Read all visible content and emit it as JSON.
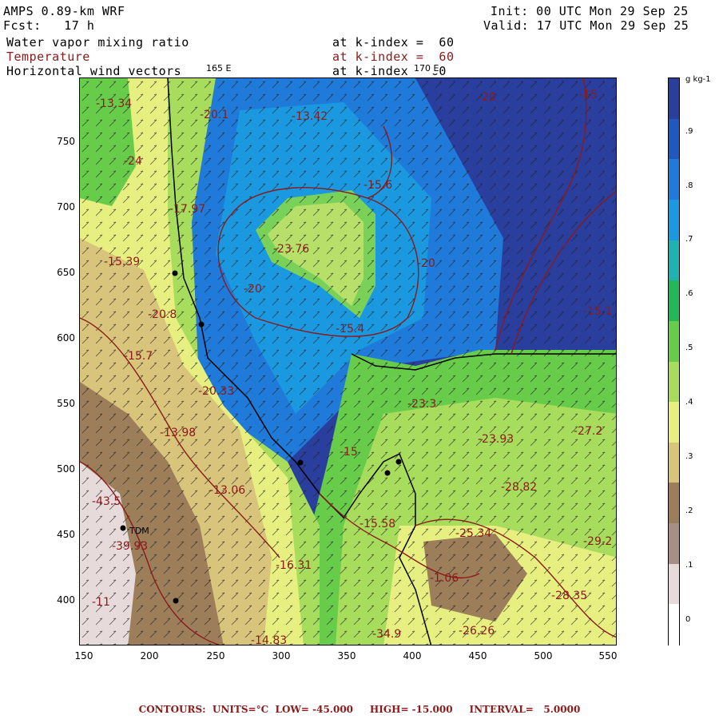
{
  "header": {
    "model": "AMPS 0.89-km WRF",
    "forecast": "Fcst:   17 h",
    "init": "Init: 00 UTC Mon 29 Sep 25",
    "valid": "Valid: 17 UTC Mon 29 Sep 25",
    "fields": [
      {
        "name": "Water vapor mixing ratio",
        "level": "at k-index =  60"
      },
      {
        "name": "Temperature",
        "level": "at k-index =  60"
      },
      {
        "name": "Horizontal wind vectors",
        "level": "at k-index = 60"
      }
    ],
    "lon_labels": [
      "165 E",
      "170 E"
    ]
  },
  "axes": {
    "y_ticks": [
      "750",
      "700",
      "650",
      "600",
      "550",
      "500",
      "450",
      "400"
    ],
    "x_ticks": [
      "150",
      "200",
      "250",
      "300",
      "350",
      "400",
      "450",
      "500",
      "550"
    ]
  },
  "colorbar": {
    "unit": "g kg-1",
    "labels": [
      ".9",
      ".8",
      ".7",
      ".6",
      ".5",
      ".4",
      ".3",
      ".2",
      ".1",
      "0"
    ],
    "colors": [
      "#2a3e9e",
      "#2158bf",
      "#1f7ad9",
      "#1a98e0",
      "#20b2b0",
      "#22b85a",
      "#66cc4a",
      "#a8dc5c",
      "#e6ef80",
      "#d8c47a",
      "#9c7e5a",
      "#a78e86",
      "#e6dada",
      "#ffffff"
    ]
  },
  "map_labels": [
    {
      "text": "-13.34"
    },
    {
      "text": "-20.1"
    },
    {
      "text": "-13.42"
    },
    {
      "text": "-20"
    },
    {
      "text": "-15"
    },
    {
      "text": "-24"
    },
    {
      "text": "-15.6"
    },
    {
      "text": "-17.97"
    },
    {
      "text": "-23.76"
    },
    {
      "text": "-20"
    },
    {
      "text": "-15.39"
    },
    {
      "text": "-20"
    },
    {
      "text": "-20.8"
    },
    {
      "text": "-15.4"
    },
    {
      "text": "-15.1"
    },
    {
      "text": "-15.7"
    },
    {
      "text": "-20.33"
    },
    {
      "text": "-23.3"
    },
    {
      "text": "-13.98"
    },
    {
      "text": "-23.93"
    },
    {
      "text": "-27.2"
    },
    {
      "text": "-15"
    },
    {
      "text": "-13.06"
    },
    {
      "text": "-28.82"
    },
    {
      "text": "-43.5"
    },
    {
      "text": "-15.58"
    },
    {
      "text": "-25.34"
    },
    {
      "text": "-39.93"
    },
    {
      "text": "-29.2"
    },
    {
      "text": "-16.31"
    },
    {
      "text": "-1.06"
    },
    {
      "text": "-28.35"
    },
    {
      "text": "-11"
    },
    {
      "text": "-34.9"
    },
    {
      "text": "-26.26"
    },
    {
      "text": "-14.83"
    },
    {
      "text": "TDM"
    }
  ],
  "footer": "CONTOURS:  UNITS=°C  LOW= -45.000     HIGH= -15.000     INTERVAL=   5.0000"
}
